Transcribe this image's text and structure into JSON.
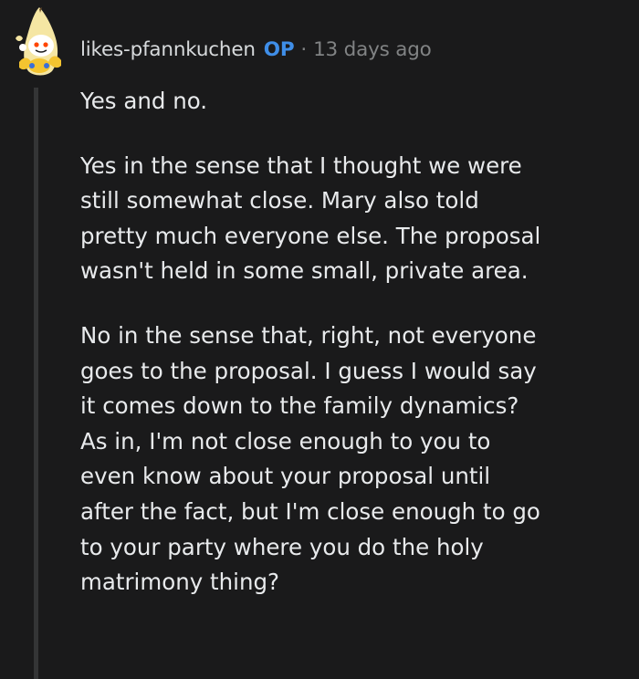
{
  "comment": {
    "author": "likes-pfannkuchen",
    "badge": "OP",
    "separator": "·",
    "timestamp": "13 days ago",
    "paragraphs": [
      {
        "lines": [
          "Yes and no."
        ]
      },
      {
        "lines": [
          "Yes in the sense that I thought we were",
          "still somewhat close. Mary also told",
          "pretty much everyone else. The proposal",
          "wasn't held in some small, private area."
        ]
      },
      {
        "lines": [
          "No in the sense that, right, not everyone",
          "goes to the proposal. I guess I would say",
          "it comes down to the family dynamics?",
          "As in, I'm not close enough to you to",
          "even know about your proposal until",
          "after the fact, but I'm close enough to go",
          "to your party where you do the holy",
          "matrimony thing?"
        ]
      }
    ]
  },
  "avatar": {
    "icon": "snoo-banana-avatar-icon"
  },
  "colors": {
    "background": "#1a1a1b",
    "text": "#d7dadc",
    "op_badge": "#3f8ee8",
    "muted": "#818384",
    "thread_line": "#343536"
  }
}
